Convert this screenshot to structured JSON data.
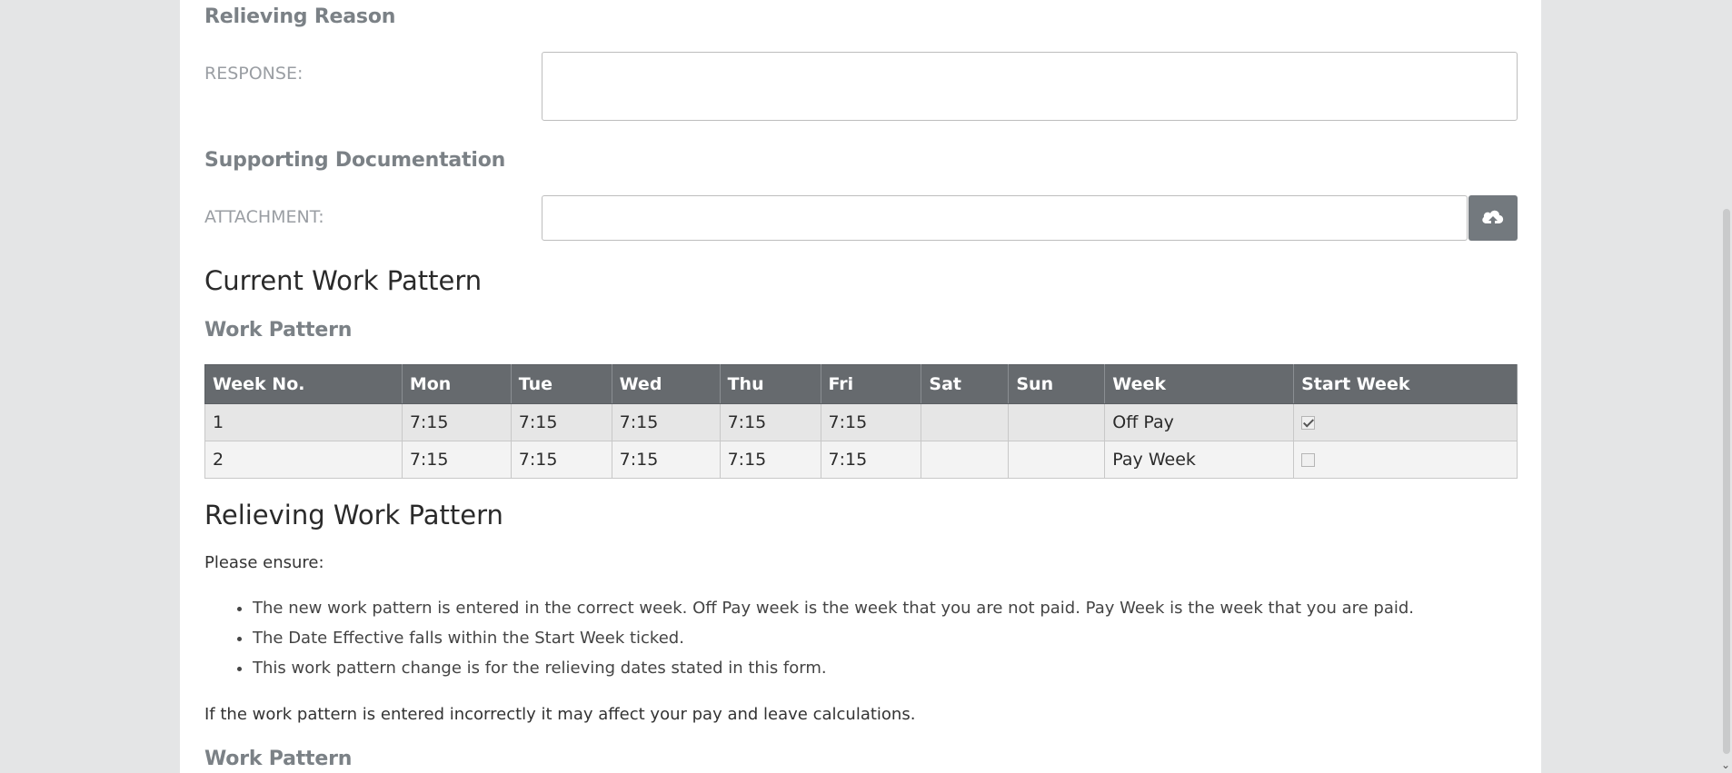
{
  "relieving_reason": {
    "heading": "Relieving Reason",
    "response_label": "RESPONSE:",
    "response_value": ""
  },
  "supporting_documentation": {
    "heading": "Supporting Documentation",
    "attachment_label": "ATTACHMENT:",
    "attachment_value": "",
    "upload_icon": "cloud-upload-icon"
  },
  "current_work_pattern": {
    "title": "Current Work Pattern",
    "subheading": "Work Pattern",
    "columns": [
      "Week No.",
      "Mon",
      "Tue",
      "Wed",
      "Thu",
      "Fri",
      "Sat",
      "Sun",
      "Week",
      "Start Week"
    ],
    "rows": [
      {
        "week_no": "1",
        "mon": "7:15",
        "tue": "7:15",
        "wed": "7:15",
        "thu": "7:15",
        "fri": "7:15",
        "sat": "",
        "sun": "",
        "week": "Off Pay",
        "start_week": true
      },
      {
        "week_no": "2",
        "mon": "7:15",
        "tue": "7:15",
        "wed": "7:15",
        "thu": "7:15",
        "fri": "7:15",
        "sat": "",
        "sun": "",
        "week": "Pay Week",
        "start_week": false
      }
    ]
  },
  "relieving_work_pattern": {
    "title": "Relieving Work Pattern",
    "intro": "Please ensure:",
    "bullets": [
      "The new work pattern is entered in the correct week. Off Pay week is the week that you are not paid. Pay Week is the week that you are paid.",
      "The Date Effective falls within the Start Week ticked.",
      "This work pattern change is for the relieving dates stated in this form."
    ],
    "warning": "If the work pattern is entered incorrectly it may affect your pay and leave calculations.",
    "subheading": "Work Pattern"
  },
  "colors": {
    "header_bg": "#666a6e",
    "upload_button": "#73797e",
    "heading_gray": "#7b8186"
  }
}
